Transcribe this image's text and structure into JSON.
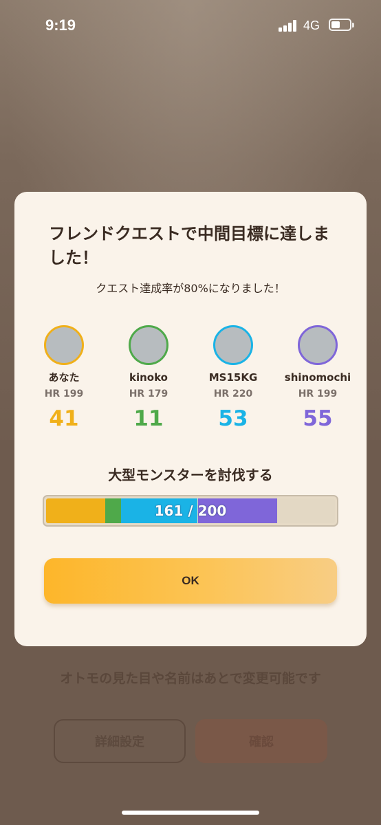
{
  "status_bar": {
    "time": "9:19",
    "network": "4G"
  },
  "background": {
    "note": "オトモの見た目や名前はあとで変更可能です",
    "detail_button": "詳細設定",
    "confirm_button": "確認"
  },
  "modal": {
    "title": "フレンドクエストで中間目標に達しました！",
    "subtitle": "クエスト達成率が80%になりました！",
    "members": [
      {
        "name": "あなた",
        "hr": "HR 199",
        "score": "41",
        "color": "#f0b01a"
      },
      {
        "name": "kinoko",
        "hr": "HR 179",
        "score": "11",
        "color": "#4fa94a"
      },
      {
        "name": "MS15KG",
        "hr": "HR 220",
        "score": "53",
        "color": "#1ab3e6"
      },
      {
        "name": "shinomochi",
        "hr": "HR 199",
        "score": "55",
        "color": "#7f66d9"
      }
    ],
    "goal_label": "大型モンスターを討伐する",
    "progress": {
      "text": "161 / 200",
      "current": 161,
      "target": 200,
      "segments": [
        {
          "member": "あなた",
          "value": 41,
          "color": "#f0b01a"
        },
        {
          "member": "kinoko",
          "value": 11,
          "color": "#4fa94a"
        },
        {
          "member": "MS15KG",
          "value": 53,
          "color": "#1ab3e6"
        },
        {
          "member": "shinomochi",
          "value": 55,
          "color": "#7f66d9"
        }
      ]
    },
    "ok_button": "OK"
  }
}
